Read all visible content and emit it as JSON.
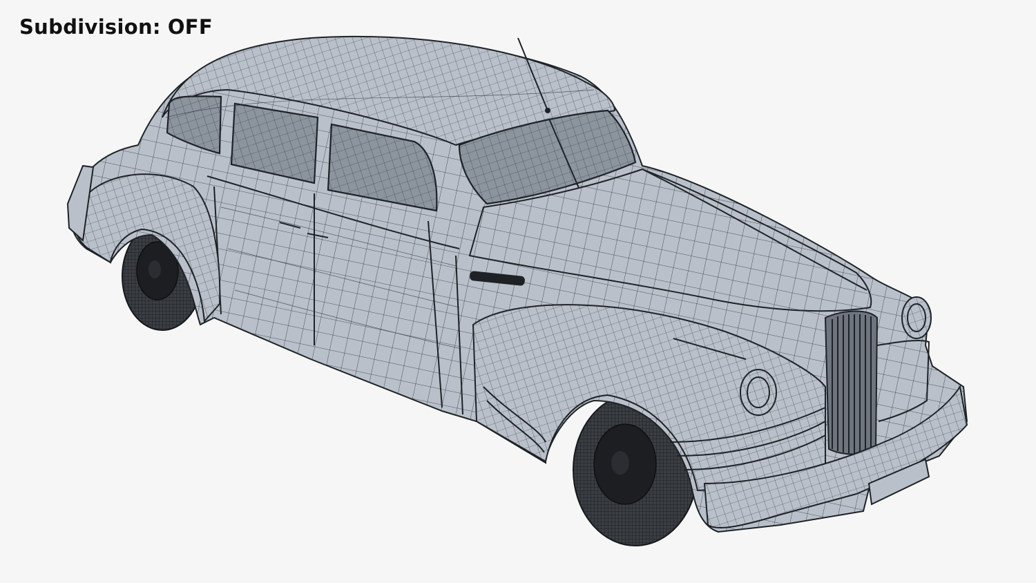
{
  "overlay": {
    "label": "Subdivision:",
    "value": "OFF"
  },
  "subject": {
    "icon": "wireframe-car-render"
  },
  "colors": {
    "background": "#f6f6f6",
    "mesh_surface": "#b9c0ca",
    "wire": "#2b3036",
    "caption_text": "#111111"
  }
}
